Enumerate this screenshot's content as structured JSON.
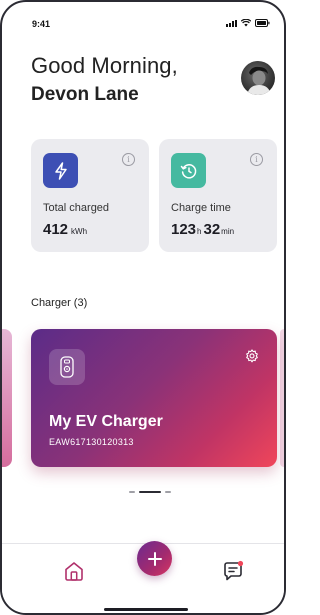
{
  "status_bar": {
    "time": "9:41",
    "icons": [
      "signal-icon",
      "wifi-icon",
      "battery-icon"
    ]
  },
  "header": {
    "greeting": "Good Morning,",
    "user_name": "Devon Lane",
    "avatar_icon": "avatar"
  },
  "stats": [
    {
      "icon": "lightning-icon",
      "accent": "#3d4fb4",
      "label": "Total charged",
      "value": "412",
      "unit": "kWh"
    },
    {
      "icon": "history-clock-icon",
      "accent": "#45b9a0",
      "label": "Charge time",
      "hours": "123",
      "hours_unit": "h",
      "minutes": "32",
      "minutes_unit": "min"
    }
  ],
  "chargers": {
    "title": "Charger (3)",
    "active_page": 2,
    "page_count": 3,
    "card": {
      "name": "My EV Charger",
      "serial": "EAW617130120313",
      "icon": "charger-icon",
      "settings_icon": "gear-icon"
    }
  },
  "nav": {
    "items": [
      "home-icon",
      "plus-icon",
      "message-icon"
    ],
    "accent": "#a42a6e",
    "notification_color": "#f0465a"
  }
}
